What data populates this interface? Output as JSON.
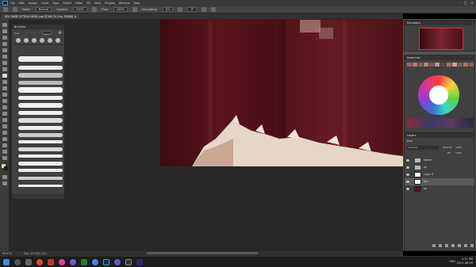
{
  "menubar": {
    "items": [
      "File",
      "Edit",
      "Image",
      "Layer",
      "Type",
      "Select",
      "Filter",
      "3D",
      "View",
      "Plugins",
      "Window",
      "Help"
    ],
    "window_controls": [
      "–",
      "□",
      "✕"
    ]
  },
  "options": {
    "mode_label": "Mode:",
    "mode_value": "Normal",
    "opacity_label": "Opacity:",
    "opacity_value": "100%",
    "flow_label": "Flow:",
    "flow_value": "100%",
    "smoothing_label": "Smoothing:",
    "smoothing_value": "0%",
    "angle_value": "0°"
  },
  "document": {
    "tab_title": "SEX GAME SITTING NEW2.psd @ 66.7% (fun, RGB/8)  ×"
  },
  "brushes_panel": {
    "title": "Brushes",
    "size_label": "Size:",
    "size_value": "12 px"
  },
  "navigator_panel": {
    "title": "Navigator"
  },
  "swatches_panel": {
    "title": "Swatches"
  },
  "layers_panel": {
    "title": "Layers",
    "kind_label": "Kind",
    "blend_value": "Normal",
    "opacity_label": "Opacity:",
    "opacity_value": "100%",
    "fill_label": "Fill:",
    "fill_value": "100%",
    "layers": [
      {
        "name": "sketch",
        "type": "folder",
        "visible": true
      },
      {
        "name": "bg",
        "type": "folder",
        "visible": true
      },
      {
        "name": "Layer 4",
        "type": "layer",
        "visible": true
      },
      {
        "name": "fun",
        "type": "layer",
        "visible": true,
        "selected": true
      },
      {
        "name": "bg",
        "type": "layer",
        "visible": true
      }
    ]
  },
  "status": {
    "zoom": "66.67%",
    "doc_size": "Doc: 45.3M/2.12G"
  },
  "taskbar": {
    "tray_text": "ENG",
    "time": "2:11 PM",
    "date": "2021-08-09"
  },
  "colors": {
    "accent": "#31a8ff",
    "canvas_dark": "#282828",
    "panel": "#404040"
  }
}
